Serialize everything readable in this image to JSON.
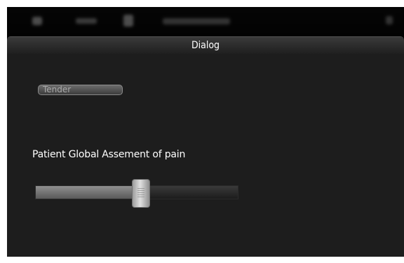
{
  "window": {
    "title": "Dialog"
  },
  "dialog": {
    "tender_button_label": "Tender",
    "slider": {
      "label": "Patient Global Assement of pain",
      "value_fraction": 0.52
    }
  },
  "colors": {
    "dialog_background": "#1d1d1d",
    "title_text": "#ffffff",
    "button_text": "#a9a9a9"
  }
}
